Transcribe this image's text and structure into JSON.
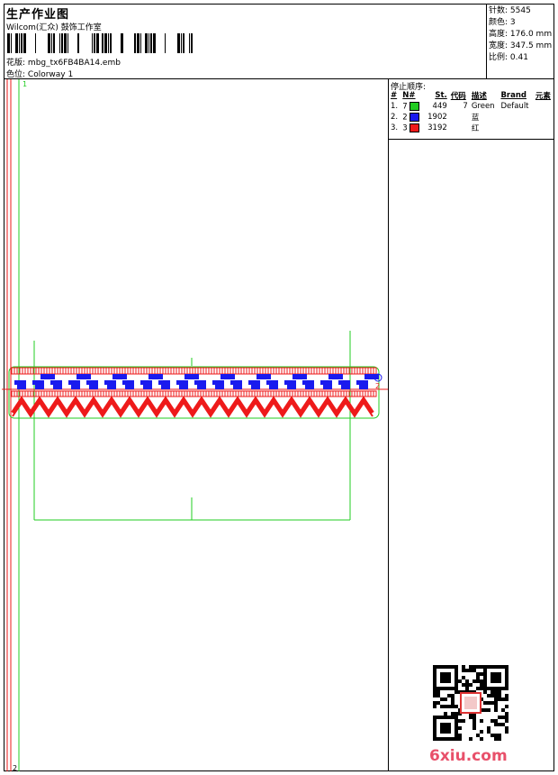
{
  "header": {
    "title": "生产作业图",
    "company": "Wilcom(汇众) 鼓饰工作室",
    "design_label": "花版:",
    "design_file": "mbg_tx6FB4BA14.emb",
    "colorway_label": "色位:",
    "colorway": "Colorway 1"
  },
  "stats": [
    {
      "label": "针数:",
      "value": "5545"
    },
    {
      "label": "颜色:",
      "value": "3"
    },
    {
      "label": "高度:",
      "value": "176.0 mm"
    },
    {
      "label": "宽度:",
      "value": "347.5 mm"
    },
    {
      "label": "比例:",
      "value": "0.41"
    }
  ],
  "stop_sequence": {
    "title": "停止顺序:",
    "columns": [
      "#",
      "N#",
      "St.",
      "代码",
      "描述",
      "Brand",
      "元素"
    ],
    "rows": [
      {
        "idx": "1.",
        "needle": "7",
        "color": "#22cc22",
        "stitches": "449",
        "code": "7",
        "desc": "Green",
        "brand": "Default"
      },
      {
        "idx": "2.",
        "needle": "2",
        "color": "#1a1aee",
        "stitches": "1902",
        "code": "",
        "desc": "蓝",
        "brand": ""
      },
      {
        "idx": "3.",
        "needle": "3",
        "color": "#ee1a1a",
        "stitches": "3192",
        "code": "",
        "desc": "红",
        "brand": ""
      }
    ]
  },
  "markers": {
    "start": "1",
    "end": "2",
    "arrow": "2"
  },
  "watermark": {
    "site": "6xiu.com"
  },
  "colors": {
    "green": "#22cc22",
    "blue": "#1a1aee",
    "red": "#ee1a1a",
    "frame": "#000000"
  }
}
